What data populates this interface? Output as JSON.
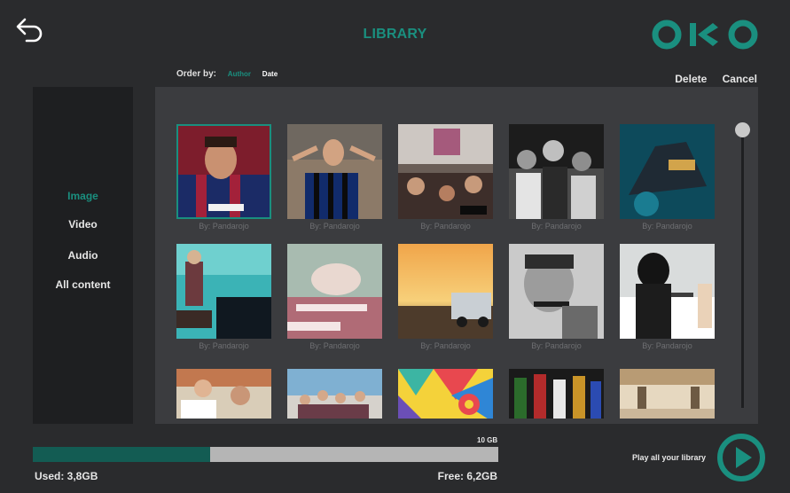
{
  "header": {
    "title": "LIBRARY",
    "logo_text": "OKO",
    "back_icon": "back-arrow-icon"
  },
  "toolbar": {
    "order_by_label": "Order by:",
    "order_options": [
      "Author",
      "Date"
    ],
    "active_order": "Author",
    "delete_label": "Delete",
    "cancel_label": "Cancel"
  },
  "sidebar": {
    "items": [
      {
        "label": "Image",
        "active": true
      },
      {
        "label": "Video",
        "active": false
      },
      {
        "label": "Audio",
        "active": false
      },
      {
        "label": "All content",
        "active": false
      }
    ]
  },
  "grid": {
    "items": [
      {
        "caption": "By: Pandarojo",
        "selected": true
      },
      {
        "caption": "By: Pandarojo",
        "selected": false
      },
      {
        "caption": "By: Pandarojo",
        "selected": false
      },
      {
        "caption": "By: Pandarojo",
        "selected": false
      },
      {
        "caption": "By: Pandarojo",
        "selected": false
      },
      {
        "caption": "By: Pandarojo",
        "selected": false
      },
      {
        "caption": "By: Pandarojo",
        "selected": false
      },
      {
        "caption": "By: Pandarojo",
        "selected": false
      },
      {
        "caption": "By: Pandarojo",
        "selected": false
      },
      {
        "caption": "By: Pandarojo",
        "selected": false
      },
      {
        "caption": "",
        "selected": false
      },
      {
        "caption": "",
        "selected": false
      },
      {
        "caption": "",
        "selected": false
      },
      {
        "caption": "",
        "selected": false
      },
      {
        "caption": "",
        "selected": false
      }
    ]
  },
  "storage": {
    "capacity_label": "10 GB",
    "used_label": "Used: 3,8GB",
    "free_label": "Free: 6,2GB",
    "used_fraction": 0.38
  },
  "playback": {
    "label": "Play all your library"
  },
  "colors": {
    "accent": "#1a8f7f",
    "background": "#2a2b2d",
    "panel": "#3b3c3f",
    "sidebar": "#1e1f21"
  }
}
